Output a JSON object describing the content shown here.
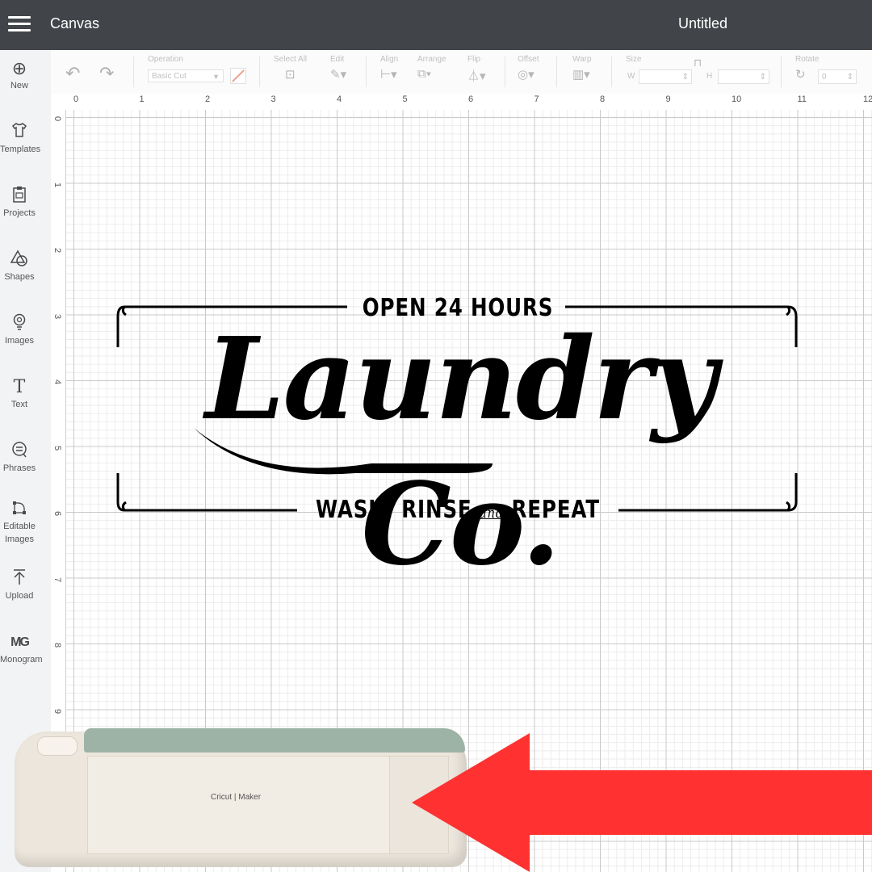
{
  "header": {
    "menu_icon": "hamburger-icon",
    "title": "Canvas",
    "document_name": "Untitled"
  },
  "sidebar": {
    "items": [
      {
        "label": "New",
        "icon": "plus-circle-icon"
      },
      {
        "label": "Templates",
        "icon": "shirt-icon"
      },
      {
        "label": "Projects",
        "icon": "clipboard-icon"
      },
      {
        "label": "Shapes",
        "icon": "shapes-icon"
      },
      {
        "label": "Images",
        "icon": "bulb-icon"
      },
      {
        "label": "Text",
        "icon": "text-icon"
      },
      {
        "label": "Phrases",
        "icon": "speech-bubble-icon"
      },
      {
        "label": "Editable Images",
        "icon": "node-edit-icon"
      },
      {
        "label": "Upload",
        "icon": "upload-icon"
      },
      {
        "label": "Monogram",
        "icon": "monogram-icon"
      }
    ]
  },
  "toolbar": {
    "operation_label": "Operation",
    "operation_value": "Basic Cut",
    "select_all_label": "Select All",
    "edit_label": "Edit",
    "align_label": "Align",
    "arrange_label": "Arrange",
    "flip_label": "Flip",
    "offset_label": "Offset",
    "warp_label": "Warp",
    "size_label": "Size",
    "w_label": "W",
    "h_label": "H",
    "rotate_label": "Rotate",
    "rotate_value": "0"
  },
  "ruler": {
    "top": [
      "0",
      "1",
      "2",
      "3",
      "4",
      "5",
      "6",
      "7",
      "8",
      "9",
      "10",
      "11",
      "12"
    ],
    "left": [
      "0",
      "1",
      "2",
      "3",
      "4",
      "5",
      "6",
      "7",
      "8",
      "9"
    ]
  },
  "design": {
    "top_line": "OPEN 24 HOURS",
    "main": "Laundry Co.",
    "bottom_line_1": "WASH, RINSE",
    "bottom_and": "and",
    "bottom_line_2": "REPEAT"
  },
  "machine": {
    "brand": "Cricut | Maker",
    "lid_color": "#9db3a6",
    "body_color": "#ece6dc"
  },
  "arrow": {
    "color": "#ff3131",
    "direction": "left"
  }
}
